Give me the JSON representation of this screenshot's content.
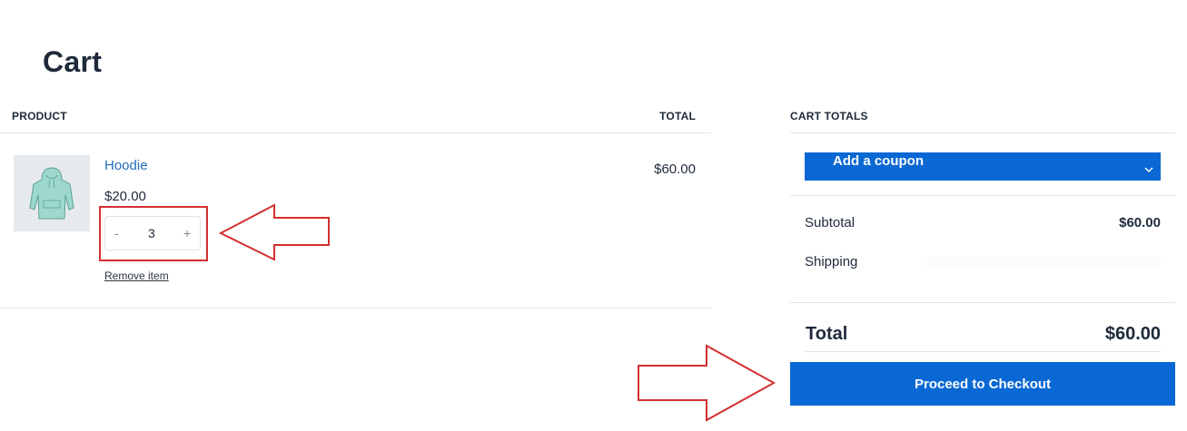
{
  "page": {
    "title": "Cart"
  },
  "cart_table": {
    "headers": {
      "product": "PRODUCT",
      "total": "TOTAL"
    },
    "items": [
      {
        "name": "Hoodie",
        "unit_price": "$20.00",
        "quantity": "3",
        "minus_label": "-",
        "plus_label": "+",
        "remove_label": "Remove item",
        "line_total": "$60.00",
        "image_icon": "hoodie-thumbnail"
      }
    ]
  },
  "cart_totals": {
    "heading": "CART TOTALS",
    "coupon_label": "Add a coupon",
    "subtotal_label": "Subtotal",
    "subtotal_value": "$60.00",
    "shipping_label": "Shipping",
    "total_label": "Total",
    "total_value": "$60.00",
    "checkout_label": "Proceed to Checkout"
  },
  "colors": {
    "accent": "#0a68d4",
    "link": "#1e6cb8",
    "text": "#1e2a3a",
    "annotation": "#d32f2f"
  }
}
